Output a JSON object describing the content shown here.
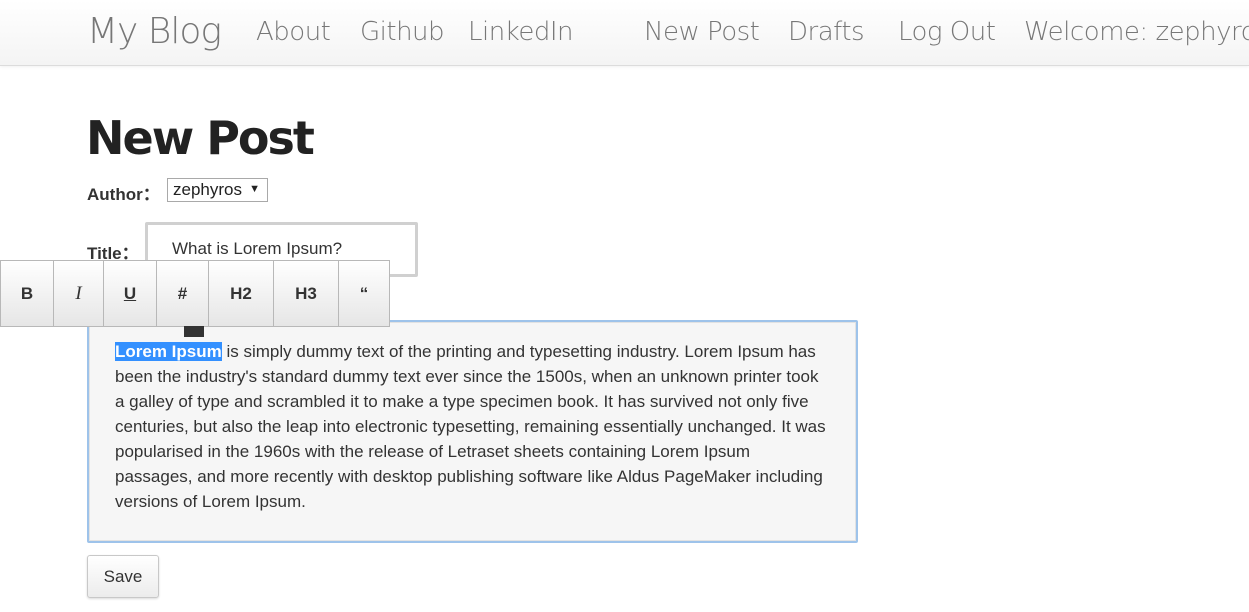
{
  "navbar": {
    "brand": "My Blog",
    "links": [
      "About",
      "Github",
      "LinkedIn"
    ],
    "right_links": [
      "New Post",
      "Drafts",
      "Log Out"
    ],
    "welcome": "Welcome: zephyros"
  },
  "page": {
    "title": "New Post"
  },
  "form": {
    "author_label": "Author：",
    "author_value": "zephyros",
    "title_label": "Title：",
    "title_value": "What is Lorem Ipsum?",
    "save_label": "Save"
  },
  "toolbar": {
    "buttons": [
      "B",
      "I",
      "U",
      "#",
      "H2",
      "H3",
      "“"
    ]
  },
  "editor": {
    "selected_text": "Lorem Ipsum",
    "body_text": " is simply dummy text of the printing and typesetting industry. Lorem Ipsum has been the industry's standard dummy text ever since the 1500s, when an unknown printer took a galley of type and scrambled it to make a type specimen book. It has survived not only five centuries, but also the leap into electronic typesetting, remaining essentially unchanged. It was popularised in the 1960s with the release of Letraset sheets containing Lorem Ipsum passages, and more recently with desktop publishing software like Aldus PageMaker including versions of Lorem Ipsum."
  },
  "colors": {
    "selection": "#3390ff",
    "editor_border": "#9ec3ea",
    "nav_text": "#777777"
  }
}
